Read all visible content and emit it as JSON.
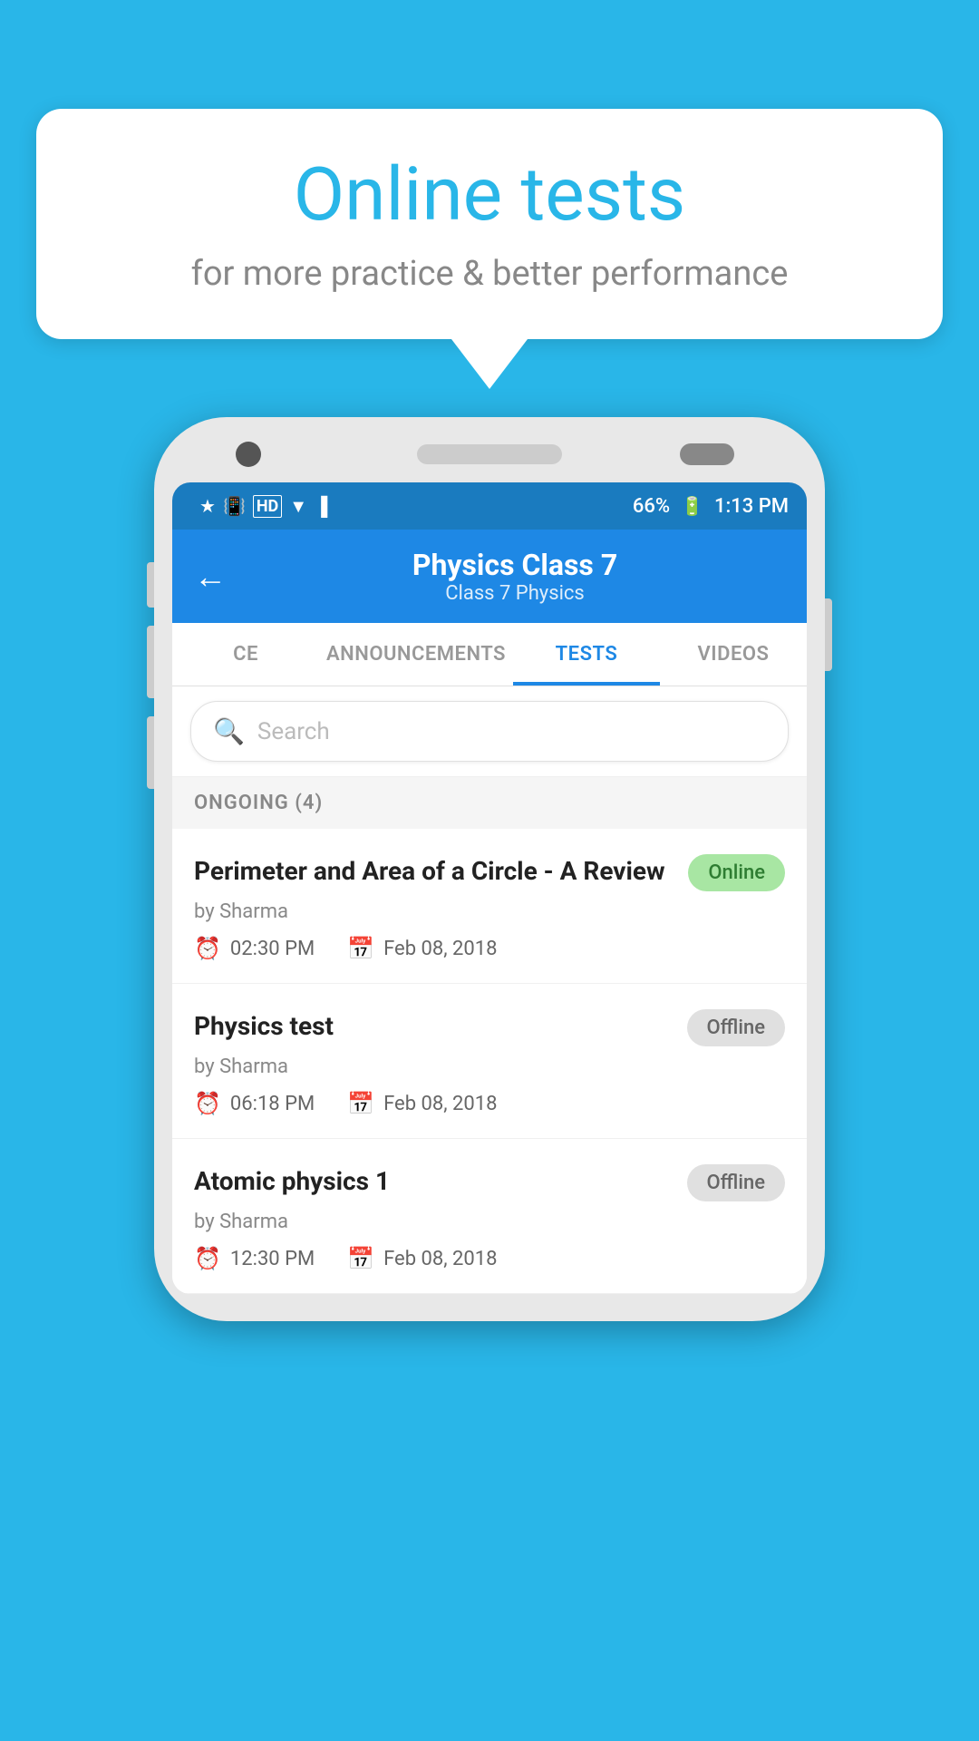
{
  "background": {
    "color": "#29b6e8"
  },
  "speech_bubble": {
    "title": "Online tests",
    "subtitle": "for more practice & better performance"
  },
  "phone": {
    "status_bar": {
      "time": "1:13 PM",
      "battery": "66%",
      "icons": [
        "bluetooth",
        "vibrate",
        "hd",
        "wifi",
        "signal",
        "x-signal"
      ]
    },
    "header": {
      "back_label": "←",
      "title": "Physics Class 7",
      "subtitle": "Class 7   Physics"
    },
    "tabs": [
      {
        "label": "CE",
        "active": false
      },
      {
        "label": "ANNOUNCEMENTS",
        "active": false
      },
      {
        "label": "TESTS",
        "active": true
      },
      {
        "label": "VIDEOS",
        "active": false
      }
    ],
    "search": {
      "placeholder": "Search"
    },
    "section": {
      "label": "ONGOING (4)"
    },
    "tests": [
      {
        "title": "Perimeter and Area of a Circle - A Review",
        "author": "by Sharma",
        "time": "02:30 PM",
        "date": "Feb 08, 2018",
        "status": "Online",
        "status_type": "online"
      },
      {
        "title": "Physics test",
        "author": "by Sharma",
        "time": "06:18 PM",
        "date": "Feb 08, 2018",
        "status": "Offline",
        "status_type": "offline"
      },
      {
        "title": "Atomic physics 1",
        "author": "by Sharma",
        "time": "12:30 PM",
        "date": "Feb 08, 2018",
        "status": "Offline",
        "status_type": "offline"
      }
    ]
  }
}
